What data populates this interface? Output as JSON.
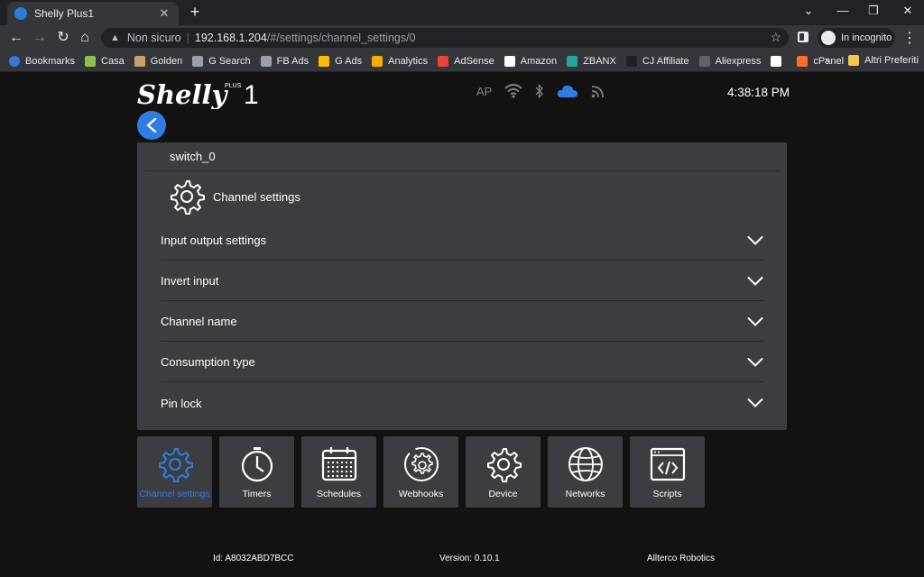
{
  "browser": {
    "tab_title": "Shelly Plus1",
    "tab_close": "✕",
    "new_tab": "+",
    "url_not_secure": "Non sicuro",
    "url_host": "192.168.1.204",
    "url_path": "/#/settings/channel_settings/0",
    "incognito_label": "In incognito",
    "bookmarks_more": "»",
    "bookmarks": [
      {
        "label": "Bookmarks",
        "color": "#3c78d8"
      },
      {
        "label": "Casa",
        "color": "#8bc34a"
      },
      {
        "label": "Golden",
        "color": "#c8a26b"
      },
      {
        "label": "G Search",
        "color": "#9aa0a6"
      },
      {
        "label": "FB Ads",
        "color": "#9aa0a6"
      },
      {
        "label": "G Ads",
        "color": "#fbbc04"
      },
      {
        "label": "Analytics",
        "color": "#f9ab00"
      },
      {
        "label": "AdSense",
        "color": "#ea4335"
      },
      {
        "label": "Amazon",
        "color": "#ffffff"
      },
      {
        "label": "ZBANX",
        "color": "#26a69a"
      },
      {
        "label": "CJ Affiliate",
        "color": "#202124"
      },
      {
        "label": "Aliexpress",
        "color": "#5f6368"
      },
      {
        "label": "",
        "color": "#ffffff"
      },
      {
        "label": "cPanel",
        "color": "#ff6c2c"
      }
    ],
    "bookmarks_folder": "Altri Preferiti"
  },
  "device": {
    "status_ap": "AP",
    "clock": "4:38:18 PM",
    "cloud_color": "#2f7de0",
    "accent_color": "#2f7de0"
  },
  "panel": {
    "title": "switch_0",
    "header_label": "Channel settings",
    "rows": [
      {
        "label": "Input output settings"
      },
      {
        "label": "Invert input"
      },
      {
        "label": "Channel name"
      },
      {
        "label": "Consumption type"
      },
      {
        "label": "Pin lock"
      }
    ]
  },
  "tiles": [
    {
      "label": "Channel settings",
      "icon": "gear-icon",
      "active": true
    },
    {
      "label": "Timers",
      "icon": "stopwatch-icon",
      "active": false
    },
    {
      "label": "Schedules",
      "icon": "calendar-icon",
      "active": false
    },
    {
      "label": "Webhooks",
      "icon": "webhook-gear-icon",
      "active": false
    },
    {
      "label": "Device",
      "icon": "device-gear-icon",
      "active": false
    },
    {
      "label": "Networks",
      "icon": "globe-icon",
      "active": false
    },
    {
      "label": "Scripts",
      "icon": "code-window-icon",
      "active": false
    }
  ],
  "footer": {
    "id": "Id: A8032ABD7BCC",
    "version": "Version: 0.10.1",
    "company": "Allterco Robotics"
  }
}
